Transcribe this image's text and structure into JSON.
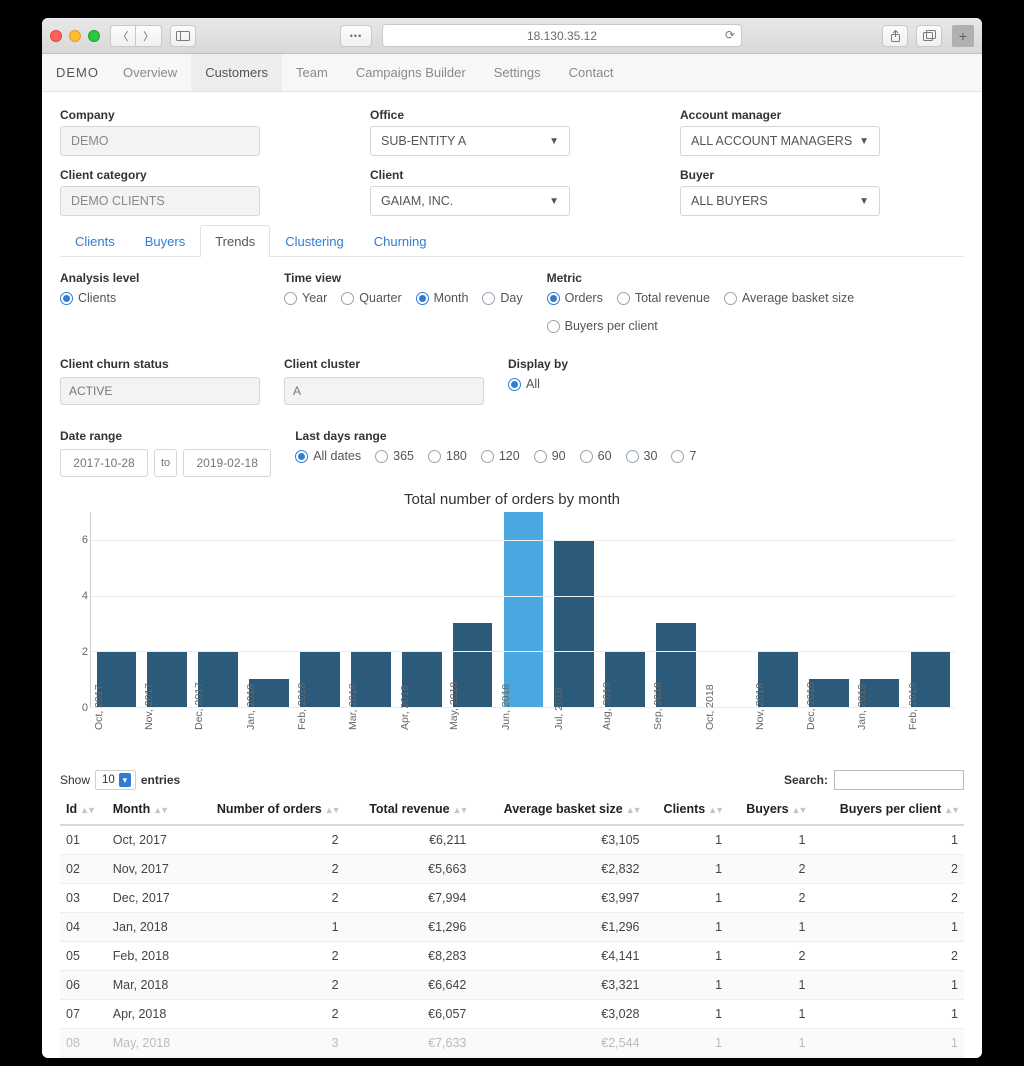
{
  "browser": {
    "url": "18.130.35.12"
  },
  "app": {
    "brand": "DEMO",
    "nav": [
      "Overview",
      "Customers",
      "Team",
      "Campaigns Builder",
      "Settings",
      "Contact"
    ],
    "nav_active": "Customers"
  },
  "filters": {
    "company": {
      "label": "Company",
      "value": "DEMO"
    },
    "office": {
      "label": "Office",
      "value": "SUB-ENTITY A"
    },
    "account_manager": {
      "label": "Account manager",
      "value": "ALL ACCOUNT MANAGERS"
    },
    "client_category": {
      "label": "Client category",
      "value": "DEMO CLIENTS"
    },
    "client": {
      "label": "Client",
      "value": "GAIAM, INC."
    },
    "buyer": {
      "label": "Buyer",
      "value": "ALL BUYERS"
    }
  },
  "subtabs": {
    "items": [
      "Clients",
      "Buyers",
      "Trends",
      "Clustering",
      "Churning"
    ],
    "active": "Trends"
  },
  "analysis": {
    "level": {
      "label": "Analysis level",
      "options": [
        "Clients"
      ],
      "selected": "Clients"
    },
    "time_view": {
      "label": "Time view",
      "options": [
        "Year",
        "Quarter",
        "Month",
        "Day"
      ],
      "selected": "Month"
    },
    "metric": {
      "label": "Metric",
      "options": [
        "Orders",
        "Total revenue",
        "Average basket size",
        "Buyers per client"
      ],
      "selected": "Orders"
    },
    "churn": {
      "label": "Client churn status",
      "value": "ACTIVE"
    },
    "cluster": {
      "label": "Client cluster",
      "value": "A"
    },
    "display": {
      "label": "Display by",
      "options": [
        "All"
      ],
      "selected": "All"
    },
    "date_range": {
      "label": "Date range",
      "from": "2017-10-28",
      "to_label": "to",
      "to": "2019-02-18"
    },
    "last_days": {
      "label": "Last days range",
      "options": [
        "All dates",
        "365",
        "180",
        "120",
        "90",
        "60",
        "30",
        "7"
      ],
      "selected": "All dates"
    }
  },
  "chart_data": {
    "type": "bar",
    "title": "Total number of orders by month",
    "xlabel": "",
    "ylabel": "",
    "ylim": [
      0,
      7
    ],
    "yticks": [
      0,
      2,
      4,
      6
    ],
    "categories": [
      "Oct, 2017",
      "Nov, 2017",
      "Dec, 2017",
      "Jan, 2018",
      "Feb, 2018",
      "Mar, 2018",
      "Apr, 2018",
      "May, 2018",
      "Jun, 2018",
      "Jul, 2018",
      "Aug, 2018",
      "Sep, 2018",
      "Oct, 2018",
      "Nov, 2018",
      "Dec, 2018",
      "Jan, 2019",
      "Feb, 2019"
    ],
    "values": [
      2,
      2,
      2,
      1,
      2,
      2,
      2,
      3,
      7,
      6,
      2,
      3,
      0,
      2,
      1,
      1,
      2
    ],
    "highlight_index": 8
  },
  "table": {
    "show_label_pre": "Show",
    "show_value": "10",
    "show_label_post": "entries",
    "search_label": "Search:",
    "columns": [
      "Id",
      "Month",
      "Number of orders",
      "Total revenue",
      "Average basket size",
      "Clients",
      "Buyers",
      "Buyers per client"
    ],
    "rows": [
      {
        "id": "01",
        "month": "Oct, 2017",
        "orders": "2",
        "revenue": "€6,211",
        "abs": "€3,105",
        "clients": "1",
        "buyers": "1",
        "bpc": "1"
      },
      {
        "id": "02",
        "month": "Nov, 2017",
        "orders": "2",
        "revenue": "€5,663",
        "abs": "€2,832",
        "clients": "1",
        "buyers": "2",
        "bpc": "2"
      },
      {
        "id": "03",
        "month": "Dec, 2017",
        "orders": "2",
        "revenue": "€7,994",
        "abs": "€3,997",
        "clients": "1",
        "buyers": "2",
        "bpc": "2"
      },
      {
        "id": "04",
        "month": "Jan, 2018",
        "orders": "1",
        "revenue": "€1,296",
        "abs": "€1,296",
        "clients": "1",
        "buyers": "1",
        "bpc": "1"
      },
      {
        "id": "05",
        "month": "Feb, 2018",
        "orders": "2",
        "revenue": "€8,283",
        "abs": "€4,141",
        "clients": "1",
        "buyers": "2",
        "bpc": "2"
      },
      {
        "id": "06",
        "month": "Mar, 2018",
        "orders": "2",
        "revenue": "€6,642",
        "abs": "€3,321",
        "clients": "1",
        "buyers": "1",
        "bpc": "1"
      },
      {
        "id": "07",
        "month": "Apr, 2018",
        "orders": "2",
        "revenue": "€6,057",
        "abs": "€3,028",
        "clients": "1",
        "buyers": "1",
        "bpc": "1"
      },
      {
        "id": "08",
        "month": "May, 2018",
        "orders": "3",
        "revenue": "€7,633",
        "abs": "€2,544",
        "clients": "1",
        "buyers": "1",
        "bpc": "1"
      }
    ]
  }
}
